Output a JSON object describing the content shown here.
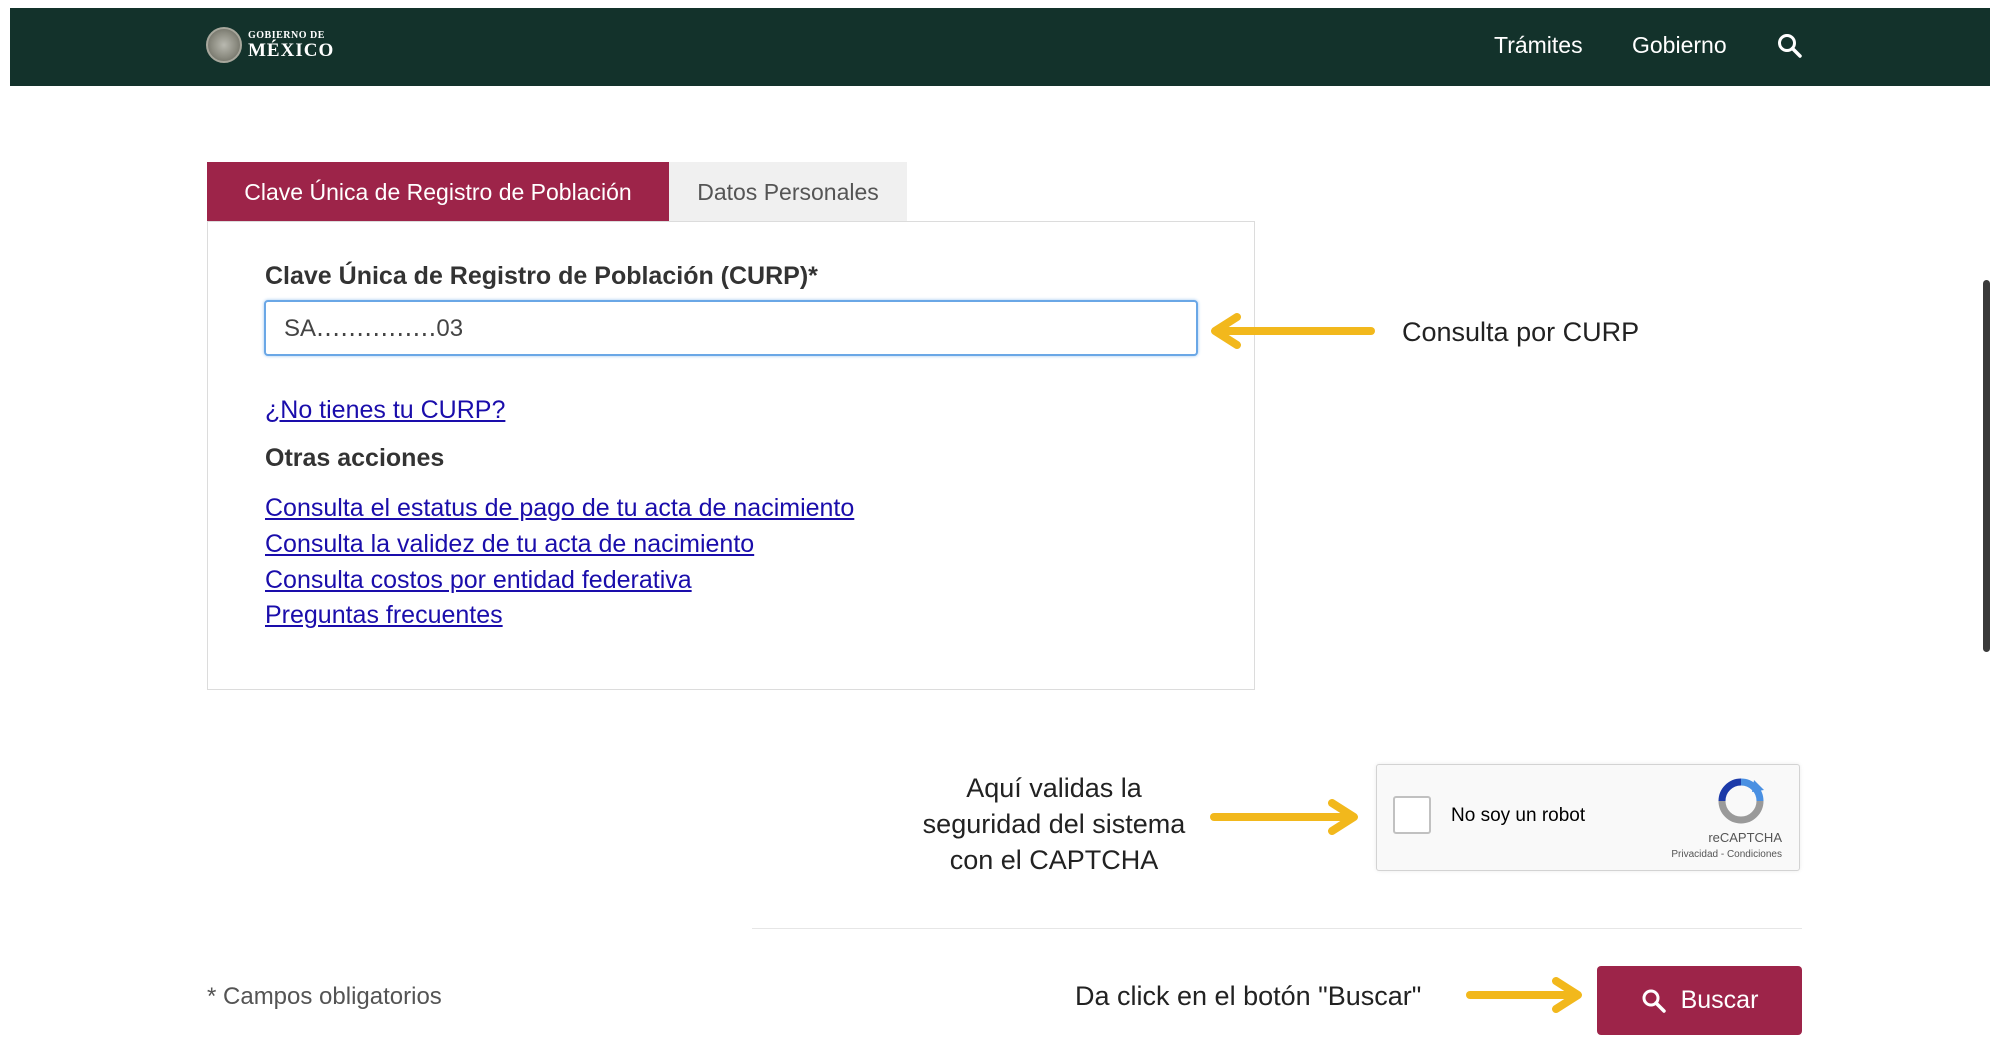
{
  "header": {
    "logo_small": "GOBIERNO DE",
    "logo_big": "MÉXICO",
    "nav": [
      "Trámites",
      "Gobierno"
    ],
    "search_icon": "search-icon",
    "bg_color": "#13322b"
  },
  "tabs": {
    "active": "Clave Única de Registro de Población",
    "inactive": "Datos Personales",
    "active_color": "#9d2449"
  },
  "form": {
    "curp_label": "Clave Única de Registro de Población (CURP)*",
    "curp_value": "SA․․․․․․․․․․․․․․․03",
    "no_curp_link": "¿No tienes tu CURP?",
    "otras_acciones": "Otras acciones",
    "links": [
      "Consulta el estatus de pago de tu acta de nacimiento",
      "Consulta la validez de tu acta de nacimiento",
      "Consulta costos por entidad federativa",
      "Preguntas frecuentes"
    ]
  },
  "annotations": {
    "curp": "Consulta por CURP",
    "captcha_lines": [
      "Aquí validas la",
      "seguridad del sistema",
      "con el CAPTCHA"
    ],
    "buscar": "Da click en el botón \"Buscar\"",
    "arrow_color": "#f2b81c"
  },
  "captcha": {
    "label": "No soy un robot",
    "brand": "reCAPTCHA",
    "links": "Privacidad - Condiciones"
  },
  "footer": {
    "required_note": "* Campos obligatorios",
    "buscar_label": "Buscar"
  }
}
